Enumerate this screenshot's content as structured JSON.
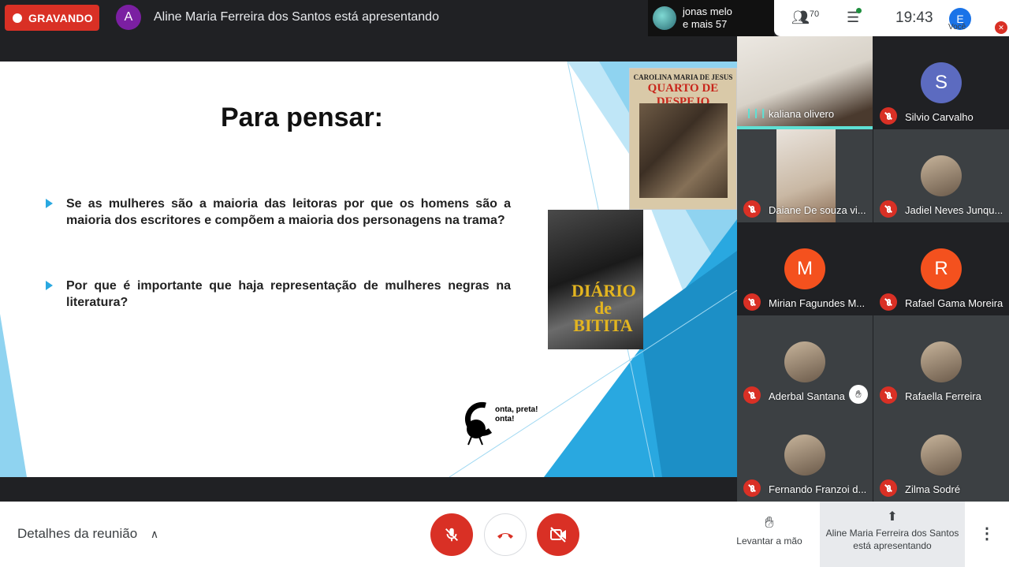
{
  "colors": {
    "recording": "#d93025",
    "accent_blue": "#29a8e0",
    "mic_muted": "#d93025",
    "speaking": "#5ee0d4",
    "presenter_avatar": "#7b1fa2"
  },
  "topbar": {
    "recording_label": "GRAVANDO",
    "presenter_initial": "A",
    "presenter_text": "Aline Maria Ferreira dos Santos está apresentando",
    "others_line1": "jonas melo",
    "others_line2": "e mais 57",
    "people_count": "70",
    "time": "19:43",
    "you_initial": "E",
    "you_label": "Você"
  },
  "slide": {
    "title": "Para pensar:",
    "bullets": [
      "Se as mulheres são a maioria das leitoras por que os homens são a maioria dos escritores e compõem a maioria dos personagens na trama?",
      "Por que é importante que haja representação de mulheres negras na literatura?"
    ],
    "book1_author": "CAROLINA MARIA DE JESUS",
    "book1_title": "QUARTO DE DESPEJO",
    "book2_title": "DIÁRIO de BITITA",
    "logo_text": "onta, preta!\nonta!"
  },
  "participants": [
    {
      "name": "kaliana olivero",
      "avatar": "",
      "color": "",
      "muted": false,
      "speaking": true,
      "photo": true
    },
    {
      "name": "Silvio Carvalho",
      "avatar": "S",
      "color": "#5c6bc0",
      "muted": true,
      "photo": false
    },
    {
      "name": "Daiane De souza vi...",
      "avatar": "",
      "color": "",
      "muted": true,
      "photo": true
    },
    {
      "name": "Jadiel Neves Junqu...",
      "avatar": "",
      "color": "",
      "muted": true,
      "photo": true
    },
    {
      "name": "Mirian Fagundes M...",
      "avatar": "M",
      "color": "#f4511e",
      "muted": true,
      "photo": false
    },
    {
      "name": "Rafael Gama Moreira",
      "avatar": "R",
      "color": "#f4511e",
      "muted": true,
      "photo": false
    },
    {
      "name": "Aderbal Santana",
      "avatar": "",
      "color": "",
      "muted": true,
      "photo": true,
      "hand": true
    },
    {
      "name": "Rafaella Ferreira",
      "avatar": "",
      "color": "",
      "muted": true,
      "photo": true
    },
    {
      "name": "Fernando Franzoi d...",
      "avatar": "",
      "color": "",
      "muted": true,
      "photo": true
    },
    {
      "name": "Zilma Sodré",
      "avatar": "",
      "color": "",
      "muted": true,
      "photo": true
    }
  ],
  "bottombar": {
    "details_label": "Detalhes da reunião",
    "raise_hand_label": "Levantar a mão",
    "presenting_label": "Aline Maria Ferreira dos Santos está apresentando"
  },
  "icons": {
    "mic_off": "mic-off-icon",
    "hang_up": "hang-up-icon",
    "camera_off": "camera-off-icon",
    "hand": "hand-icon",
    "present": "present-icon",
    "more": "more-vert-icon"
  }
}
